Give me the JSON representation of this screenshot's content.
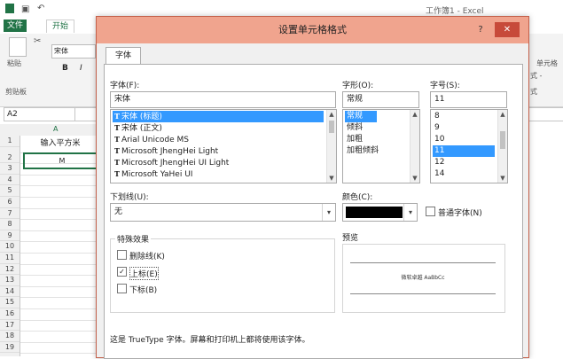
{
  "excel": {
    "title": "工作簿1 - Excel",
    "tabs": [
      "文件",
      "开始"
    ],
    "ribbon": {
      "paste": "粘贴",
      "clipboard": "剪贴板",
      "font_name": "宋体",
      "bold": "B",
      "italic": "I",
      "right_frag1": "单元格",
      "right_frag2": "式 -",
      "right_frag3": "式"
    },
    "name_box": "A2",
    "column": "A",
    "cell_a1": "输入平方米",
    "cell_a2": "M",
    "rows": [
      "1",
      "2",
      "3",
      "4",
      "5",
      "6",
      "7",
      "8",
      "9",
      "10",
      "11",
      "12",
      "13",
      "14",
      "15",
      "16",
      "17",
      "18",
      "19"
    ]
  },
  "dialog": {
    "title": "设置单元格格式",
    "help": "?",
    "close": "✕",
    "tab": "字体",
    "font_label": "字体(F):",
    "font_value": "宋体",
    "fonts": [
      "宋体 (标题)",
      "宋体 (正文)",
      "Arial Unicode MS",
      "Microsoft JhengHei Light",
      "Microsoft JhengHei UI Light",
      "Microsoft YaHei UI"
    ],
    "style_label": "字形(O):",
    "style_value": "常规",
    "styles": [
      "常规",
      "倾斜",
      "加粗",
      "加粗倾斜"
    ],
    "size_label": "字号(S):",
    "size_value": "11",
    "sizes": [
      "8",
      "9",
      "10",
      "11",
      "12",
      "14"
    ],
    "underline_label": "下划线(U):",
    "underline_value": "无",
    "color_label": "颜色(C):",
    "color_value": "#000000",
    "normal_font": "普通字体(N)",
    "effects_label": "特殊效果",
    "strikethrough": "删除线(K)",
    "superscript": "上标(E)",
    "subscript": "下标(B)",
    "preview_label": "预览",
    "preview_text": "微软卓越  AaBbCc",
    "footer": "这是 TrueType 字体。屏幕和打印机上都将使用该字体。"
  },
  "colors": {
    "excel_green": "#217346",
    "title_bar": "#f0a48e",
    "close": "#c74a3a",
    "selection": "#3399ff"
  }
}
